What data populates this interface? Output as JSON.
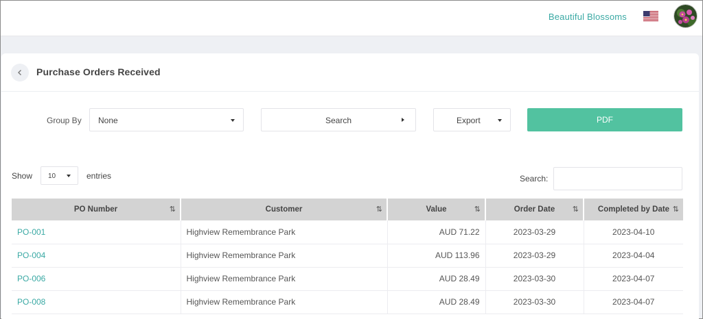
{
  "header": {
    "brand": "Beautiful Blossoms",
    "flag_icon": "us-flag-icon",
    "accent": "#3aa9a4"
  },
  "page": {
    "title": "Purchase Orders Received"
  },
  "toolbar": {
    "group_by_label": "Group By",
    "group_by_value": "None",
    "search_button": "Search",
    "export_button": "Export",
    "pdf_button": "PDF",
    "pdf_color": "#52c2a0"
  },
  "table_controls": {
    "show_label": "Show",
    "page_size": "10",
    "entries_label": "entries",
    "search_label": "Search:"
  },
  "table": {
    "columns": [
      "PO Number",
      "Customer",
      "Value",
      "Order Date",
      "Completed by Date"
    ],
    "rows": [
      {
        "po": "PO-001",
        "customer": "Highview Remembrance Park",
        "value": "AUD 71.22",
        "order_date": "2023-03-29",
        "completed": "2023-04-10"
      },
      {
        "po": "PO-004",
        "customer": "Highview Remembrance Park",
        "value": "AUD 113.96",
        "order_date": "2023-03-29",
        "completed": "2023-04-04"
      },
      {
        "po": "PO-006",
        "customer": "Highview Remembrance Park",
        "value": "AUD 28.49",
        "order_date": "2023-03-30",
        "completed": "2023-04-07"
      },
      {
        "po": "PO-008",
        "customer": "Highview Remembrance Park",
        "value": "AUD 28.49",
        "order_date": "2023-03-30",
        "completed": "2023-04-07"
      }
    ]
  }
}
